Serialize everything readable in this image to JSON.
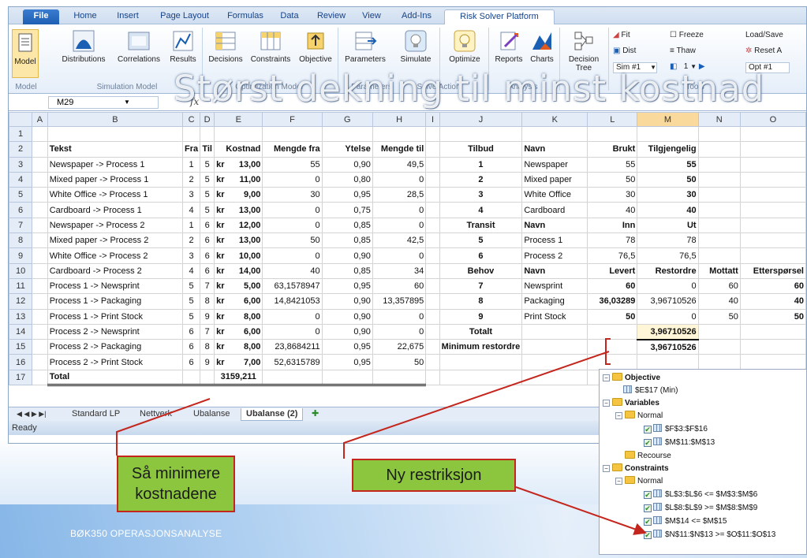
{
  "slide": {
    "title": "Størst dekning til minst kostnad",
    "footer": "BØK350 OPERASJONSANALYSE"
  },
  "ribbon": {
    "tabs": [
      "File",
      "Home",
      "Insert",
      "Page Layout",
      "Formulas",
      "Data",
      "Review",
      "View",
      "Add-Ins",
      "Risk Solver Platform"
    ],
    "buttons": {
      "model": "Model",
      "distributions": "Distributions",
      "correlations": "Correlations",
      "results": "Results",
      "decisions": "Decisions",
      "constraints": "Constraints",
      "objective": "Objective",
      "parameters": "Parameters",
      "simulate": "Simulate",
      "optimize": "Optimize",
      "reports": "Reports",
      "charts": "Charts",
      "decision_tree": "Decision Tree"
    },
    "groups": {
      "model": "Model",
      "simulation_model": "Simulation Model",
      "optimization_model": "Optimization Model",
      "parameters": "Parameters",
      "solve_action": "Solve Action",
      "analysis": "Analysis",
      "tools": "Tools"
    },
    "small": {
      "fit": "Fit",
      "dist": "Dist",
      "sim": "Sim #1",
      "freeze": "Freeze",
      "thaw": "Thaw",
      "sim_index": "1",
      "load_save": "Load/Save",
      "reset_all": "Reset A",
      "opt": "Opt #1"
    }
  },
  "formula_bar": {
    "namebox": "M29",
    "fx": "fx"
  },
  "grid": {
    "columns": [
      "A",
      "B",
      "C",
      "D",
      "E",
      "F",
      "G",
      "H",
      "I",
      "J",
      "K",
      "L",
      "M",
      "N",
      "O"
    ],
    "rows": [
      [
        "",
        "",
        "",
        "",
        "",
        "",
        "",
        "",
        "",
        "",
        "",
        "",
        "",
        "",
        ""
      ],
      [
        "",
        "Tekst",
        "Fra",
        "Til",
        "Kostnad",
        "Mengde fra",
        "Ytelse",
        "Mengde til",
        "",
        "Tilbud",
        "Navn",
        "Brukt",
        "Tilgjengelig",
        "",
        ""
      ],
      [
        "",
        "Newspaper -> Process 1",
        "1",
        "5",
        "13,00",
        "55",
        "0,90",
        "49,5",
        "",
        "1",
        "Newspaper",
        "55",
        "55",
        "",
        ""
      ],
      [
        "",
        "Mixed paper -> Process 1",
        "2",
        "5",
        "11,00",
        "0",
        "0,80",
        "0",
        "",
        "2",
        "Mixed paper",
        "50",
        "50",
        "",
        ""
      ],
      [
        "",
        "White Office -> Process 1",
        "3",
        "5",
        "9,00",
        "30",
        "0,95",
        "28,5",
        "",
        "3",
        "White Office",
        "30",
        "30",
        "",
        ""
      ],
      [
        "",
        "Cardboard -> Process 1",
        "4",
        "5",
        "13,00",
        "0",
        "0,75",
        "0",
        "",
        "4",
        "Cardboard",
        "40",
        "40",
        "",
        ""
      ],
      [
        "",
        "Newspaper -> Process 2",
        "1",
        "6",
        "12,00",
        "0",
        "0,85",
        "0",
        "",
        "Transit",
        "Navn",
        "Inn",
        "Ut",
        "",
        ""
      ],
      [
        "",
        "Mixed paper -> Process 2",
        "2",
        "6",
        "13,00",
        "50",
        "0,85",
        "42,5",
        "",
        "5",
        "Process 1",
        "78",
        "78",
        "",
        ""
      ],
      [
        "",
        "White Office -> Process 2",
        "3",
        "6",
        "10,00",
        "0",
        "0,90",
        "0",
        "",
        "6",
        "Process 2",
        "76,5",
        "76,5",
        "",
        ""
      ],
      [
        "",
        "Cardboard -> Process 2",
        "4",
        "6",
        "14,00",
        "40",
        "0,85",
        "34",
        "",
        "Behov",
        "Navn",
        "Levert",
        "Restordre",
        "Mottatt",
        "Etterspørsel"
      ],
      [
        "",
        "Process 1 -> Newsprint",
        "5",
        "7",
        "5,00",
        "63,1578947",
        "0,95",
        "60",
        "",
        "7",
        "Newsprint",
        "60",
        "0",
        "60",
        "60"
      ],
      [
        "",
        "Process 1 -> Packaging",
        "5",
        "8",
        "6,00",
        "14,8421053",
        "0,90",
        "13,357895",
        "",
        "8",
        "Packaging",
        "36,03289",
        "3,96710526",
        "40",
        "40"
      ],
      [
        "",
        "Process 1 -> Print Stock",
        "5",
        "9",
        "8,00",
        "0",
        "0,90",
        "0",
        "",
        "9",
        "Print Stock",
        "50",
        "0",
        "50",
        "50"
      ],
      [
        "",
        "Process 2 -> Newsprint",
        "6",
        "7",
        "6,00",
        "0",
        "0,90",
        "0",
        "",
        "Totalt",
        "",
        "",
        "3,96710526",
        "",
        ""
      ],
      [
        "",
        "Process 2 -> Packaging",
        "6",
        "8",
        "8,00",
        "23,8684211",
        "0,95",
        "22,675",
        "",
        "Minimum restordre",
        "",
        "",
        "3,96710526",
        "",
        ""
      ],
      [
        "",
        "Process 2 -> Print Stock",
        "6",
        "9",
        "7,00",
        "52,6315789",
        "0,95",
        "50",
        "",
        "",
        "",
        "",
        "",
        "",
        ""
      ],
      [
        "",
        "Total",
        "",
        "",
        "3159,211",
        "",
        "",
        "",
        "",
        "",
        "",
        "",
        "",
        "",
        ""
      ]
    ],
    "currency": "kr"
  },
  "sheet_tabs": [
    "Standard LP",
    "Nettverk",
    "Ubalanse",
    "Ubalanse (2)"
  ],
  "status": "Ready",
  "callouts": {
    "left": "Så minimere kostnadene",
    "right": "Ny restriksjon"
  },
  "solver_tree": {
    "objective": "Objective",
    "objective_cell": "$E$17 (Min)",
    "variables": "Variables",
    "normal": "Normal",
    "var1": "$F$3:$F$16",
    "var2": "$M$11:$M$13",
    "recourse": "Recourse",
    "constraints": "Constraints",
    "con1": "$L$3:$L$6 <= $M$3:$M$6",
    "con2": "$L$8:$L$9 >= $M$8:$M$9",
    "con3": "$M$14 <= $M$15",
    "con4": "$N$11:$N$13 >= $O$11:$O$13"
  },
  "colors": {
    "accent_blue": "#1f6fd1",
    "green": "#2aa83a",
    "red": "#e0211d",
    "callout_fill": "#8cc63f",
    "callout_border": "#c4261d"
  }
}
